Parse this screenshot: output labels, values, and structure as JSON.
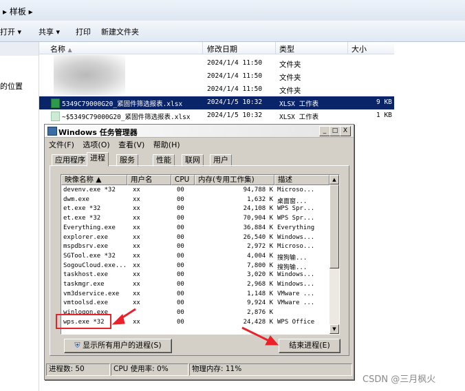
{
  "explorer": {
    "address": "▸ 样板 ▸",
    "commands": [
      "打开",
      "共享",
      "打印",
      "新建文件夹"
    ],
    "nav_location_label": "的位置",
    "columns": [
      "名称",
      "修改日期",
      "类型",
      "大小"
    ],
    "rows": [
      {
        "name": "",
        "date": "2024/1/4 11:50",
        "type": "文件夹",
        "size": ""
      },
      {
        "name": "",
        "date": "2024/1/4 11:50",
        "type": "文件夹",
        "size": ""
      },
      {
        "name": "",
        "date": "2024/1/4 11:50",
        "type": "文件夹",
        "size": ""
      },
      {
        "name": "5349C79000G20_紧固件筛选报表.xlsx",
        "date": "2024/1/5 10:32",
        "type": "XLSX 工作表",
        "size": "9 KB"
      },
      {
        "name": "~$5349C79000G20_紧固件筛选报表.xlsx",
        "date": "2024/1/5 10:32",
        "type": "XLSX 工作表",
        "size": "1 KB"
      }
    ]
  },
  "taskmgr": {
    "title": "Windows 任务管理器",
    "window_buttons": [
      "_",
      "□",
      "X"
    ],
    "menu": [
      "文件(F)",
      "选项(O)",
      "查看(V)",
      "帮助(H)"
    ],
    "tabs": [
      "应用程序",
      "进程",
      "服务",
      "性能",
      "联网",
      "用户"
    ],
    "active_tab": "进程",
    "columns": [
      "映像名称 ▲",
      "用户名",
      "CPU",
      "内存(专用工作集)",
      "描述"
    ],
    "processes": [
      {
        "name": "devenv.exe *32",
        "user": "xx",
        "cpu": "00",
        "mem": "94,788 K",
        "desc": "Microso..."
      },
      {
        "name": "dwm.exe",
        "user": "xx",
        "cpu": "00",
        "mem": "1,632 K",
        "desc": "桌面窗..."
      },
      {
        "name": "et.exe *32",
        "user": "xx",
        "cpu": "00",
        "mem": "24,108 K",
        "desc": "WPS Spr..."
      },
      {
        "name": "et.exe *32",
        "user": "xx",
        "cpu": "00",
        "mem": "70,904 K",
        "desc": "WPS Spr..."
      },
      {
        "name": "Everything.exe",
        "user": "xx",
        "cpu": "00",
        "mem": "36,884 K",
        "desc": "Everything"
      },
      {
        "name": "explorer.exe",
        "user": "xx",
        "cpu": "00",
        "mem": "26,540 K",
        "desc": "Windows..."
      },
      {
        "name": "mspdbsrv.exe",
        "user": "xx",
        "cpu": "00",
        "mem": "2,972 K",
        "desc": "Microso..."
      },
      {
        "name": "SGTool.exe *32",
        "user": "xx",
        "cpu": "00",
        "mem": "4,004 K",
        "desc": "搜狗输..."
      },
      {
        "name": "SogouCloud.exe...",
        "user": "xx",
        "cpu": "00",
        "mem": "7,800 K",
        "desc": "搜狗输..."
      },
      {
        "name": "taskhost.exe",
        "user": "xx",
        "cpu": "00",
        "mem": "3,020 K",
        "desc": "Windows..."
      },
      {
        "name": "taskmgr.exe",
        "user": "xx",
        "cpu": "00",
        "mem": "2,968 K",
        "desc": "Windows..."
      },
      {
        "name": "vm3dservice.exe",
        "user": "xx",
        "cpu": "00",
        "mem": "1,148 K",
        "desc": "VMware ..."
      },
      {
        "name": "vmtoolsd.exe",
        "user": "xx",
        "cpu": "00",
        "mem": "9,924 K",
        "desc": "VMware ..."
      },
      {
        "name": "winlogon.exe",
        "user": "",
        "cpu": "00",
        "mem": "2,876 K",
        "desc": ""
      },
      {
        "name": "wps.exe *32",
        "user": "xx",
        "cpu": "00",
        "mem": "24,428 K",
        "desc": "WPS Office"
      }
    ],
    "show_all_users_label": "显示所有用户的进程(S)",
    "end_process_label": "结束进程(E)",
    "status": {
      "processes": "进程数: 50",
      "cpu": "CPU 使用率: 0%",
      "memory": "物理内存: 11%"
    }
  },
  "watermark": "CSDN @三月枫火",
  "colors": {
    "selection": "#0a246a",
    "highlight": "#e8212b",
    "excel": "#2b9a4a"
  }
}
